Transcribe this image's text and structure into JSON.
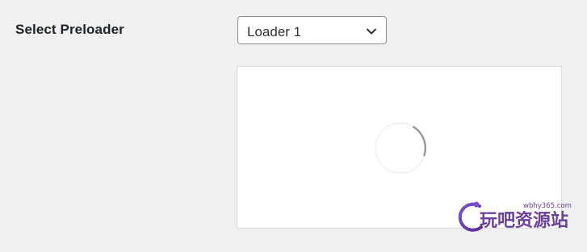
{
  "form": {
    "label": "Select Preloader",
    "select": {
      "selected": "Loader 1"
    }
  },
  "icons": {
    "dropdown": "chevron-down-icon",
    "loader": "spinner-icon"
  },
  "watermark": {
    "domain": "wbhy365.com",
    "text": "玩吧资源站"
  },
  "colors": {
    "page_bg": "#f0f0f1",
    "panel_bg": "#ffffff",
    "watermark_purple": "#6b3fa0"
  }
}
